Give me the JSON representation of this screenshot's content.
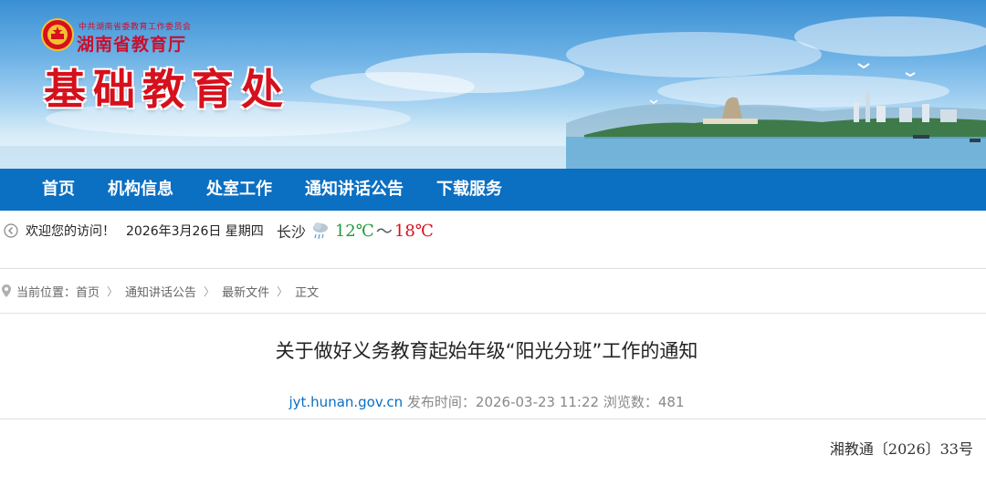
{
  "header": {
    "party_line": "中共湖南省委教育工作委员会",
    "department": "湖南省教育厅",
    "site_title": "基础教育处"
  },
  "nav": {
    "items": [
      {
        "label": "首页"
      },
      {
        "label": "机构信息"
      },
      {
        "label": "处室工作"
      },
      {
        "label": "通知讲话公告"
      },
      {
        "label": "下载服务"
      }
    ]
  },
  "infobar": {
    "welcome": "欢迎您的访问！",
    "date": "2026年3月26日 星期四",
    "city": "长沙",
    "temp_low": "12℃",
    "tilde": "～",
    "temp_high": "18℃",
    "weather_icon": "rain-cloud-icon"
  },
  "breadcrumb": {
    "prefix": "当前位置：",
    "items": [
      {
        "label": "首页"
      },
      {
        "label": "通知讲话公告"
      },
      {
        "label": "最新文件"
      }
    ],
    "current": "正文",
    "separator": "〉"
  },
  "article": {
    "title": "关于做好义务教育起始年级“阳光分班”工作的通知",
    "source": "jyt.hunan.gov.cn",
    "publish_label": "发布时间：",
    "publish_time": "2026-03-23 11:22",
    "views_label": "浏览数：",
    "views": "481",
    "doc_number": "湘教通〔2026〕33号"
  },
  "colors": {
    "nav_bg": "#0b6fc2",
    "title_red": "#d6101c",
    "temp_low": "#1f9a3a",
    "temp_high": "#d6101c"
  }
}
